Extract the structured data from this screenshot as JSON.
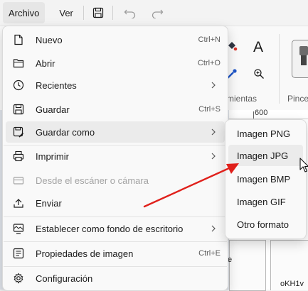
{
  "menubar": {
    "file_label": "Archivo",
    "view_label": "Ver"
  },
  "ribbon": {
    "tools_caption": "mientas",
    "brushes_caption": "Pince"
  },
  "ruler": {
    "mark_600": "600"
  },
  "canvas": {
    "snippet_e": "e",
    "snippet_code": "oKH1v"
  },
  "file_menu": {
    "items": [
      {
        "label": "Nuevo",
        "shortcut": "Ctrl+N",
        "icon": "new-file-icon"
      },
      {
        "label": "Abrir",
        "shortcut": "Ctrl+O",
        "icon": "folder-icon"
      },
      {
        "label": "Recientes",
        "icon": "clock-icon"
      },
      {
        "label": "Guardar",
        "shortcut": "Ctrl+S",
        "icon": "save-icon"
      },
      {
        "label": "Guardar como",
        "icon": "save-as-icon"
      },
      {
        "label": "Imprimir",
        "icon": "printer-icon"
      },
      {
        "label": "Desde el escáner o cámara",
        "icon": "scanner-icon"
      },
      {
        "label": "Enviar",
        "icon": "send-icon"
      },
      {
        "label": "Establecer como fondo de escritorio",
        "icon": "desktop-icon"
      },
      {
        "label": "Propiedades de imagen",
        "shortcut": "Ctrl+E",
        "icon": "image-properties-icon"
      },
      {
        "label": "Configuración",
        "icon": "gear-icon"
      }
    ]
  },
  "save_as_submenu": {
    "items": [
      {
        "label": "Imagen PNG"
      },
      {
        "label": "Imagen JPG"
      },
      {
        "label": "Imagen BMP"
      },
      {
        "label": "Imagen GIF"
      },
      {
        "label": "Otro formato"
      }
    ]
  },
  "colors": {
    "menu_bg": "#f9f9f9",
    "hover_bg": "#ebebeb",
    "annotation_arrow": "#e0201b"
  }
}
